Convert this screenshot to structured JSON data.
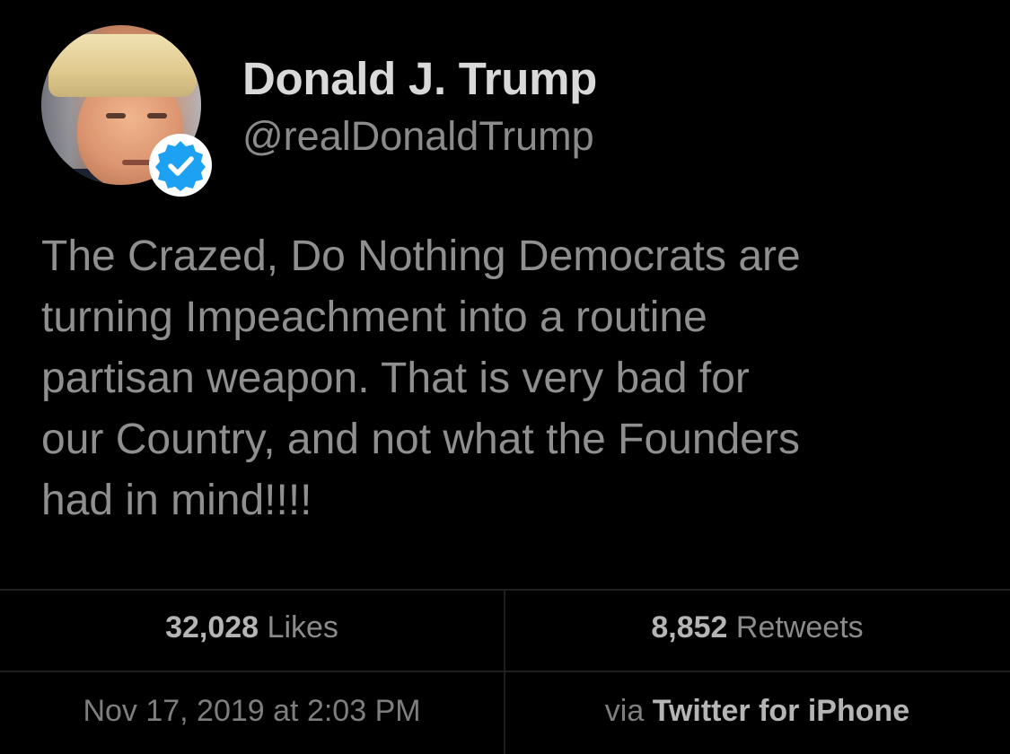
{
  "author": {
    "display_name": "Donald J. Trump",
    "handle": "@realDonaldTrump",
    "verified": true,
    "verified_icon": "verified-badge-icon",
    "verified_color": "#1da1f2"
  },
  "tweet": {
    "lines": [
      "The Crazed, Do Nothing Democrats are",
      "turning Impeachment into a routine",
      "partisan weapon. That is very bad for",
      "our Country, and not what the Founders",
      "had in mind!!!!"
    ]
  },
  "stats": {
    "likes_count": "32,028",
    "likes_label": "Likes",
    "retweets_count": "8,852",
    "retweets_label": "Retweets"
  },
  "meta": {
    "timestamp": "Nov 17, 2019 at 2:03 PM",
    "via_label": "via",
    "source_app": "Twitter for iPhone"
  },
  "colors": {
    "background": "#000000",
    "name_text": "#d9d9d9",
    "secondary_text": "#8b8b8b",
    "divider": "#1f1f1f"
  }
}
